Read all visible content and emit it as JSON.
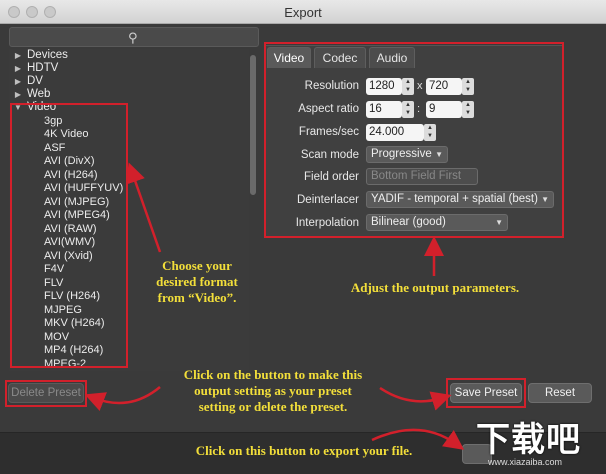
{
  "window": {
    "title": "Export"
  },
  "search": {
    "placeholder": ""
  },
  "tree": {
    "categories": [
      "Devices",
      "HDTV",
      "DV",
      "Web",
      "Video"
    ],
    "video_formats": [
      "3gp",
      "4K Video",
      "ASF",
      "AVI (DivX)",
      "AVI (H264)",
      "AVI (HUFFYUV)",
      "AVI (MJPEG)",
      "AVI (MPEG4)",
      "AVI (RAW)",
      "AVI(WMV)",
      "AVI (Xvid)",
      "F4V",
      "FLV",
      "FLV (H264)",
      "MJPEG",
      "MKV (H264)",
      "MOV",
      "MP4 (H264)",
      "MPEG-2"
    ]
  },
  "tabs": [
    "Video",
    "Codec",
    "Audio"
  ],
  "settings": {
    "resolution": {
      "label": "Resolution",
      "width": "1280",
      "height": "720",
      "sep": "x"
    },
    "aspect": {
      "label": "Aspect ratio",
      "num": "16",
      "den": "9",
      "sep": ":"
    },
    "fps": {
      "label": "Frames/sec",
      "value": "24.000"
    },
    "scan": {
      "label": "Scan mode",
      "value": "Progressive"
    },
    "field_order": {
      "label": "Field order",
      "value": "Bottom Field First"
    },
    "deinterlacer": {
      "label": "Deinterlacer",
      "value": "YADIF - temporal + spatial (best)"
    },
    "interpolation": {
      "label": "Interpolation",
      "value": "Bilinear (good)"
    }
  },
  "annotations": {
    "choose_format": [
      "Choose your",
      "desired format",
      "from “Video”."
    ],
    "adjust": "Adjust the output parameters.",
    "preset_help": [
      "Click on the button to make this",
      "output setting as your preset",
      "setting or delete the preset."
    ],
    "export_help": "Click on this button to export your file."
  },
  "buttons": {
    "delete_preset": "Delete Preset",
    "save_preset": "Save Preset",
    "reset": "Reset"
  },
  "watermark": {
    "big": "下载吧",
    "small": "www.xiazaiba.com"
  },
  "colors": {
    "annotation_red": "#d2202b",
    "annotation_yellow": "#f3df3a"
  }
}
